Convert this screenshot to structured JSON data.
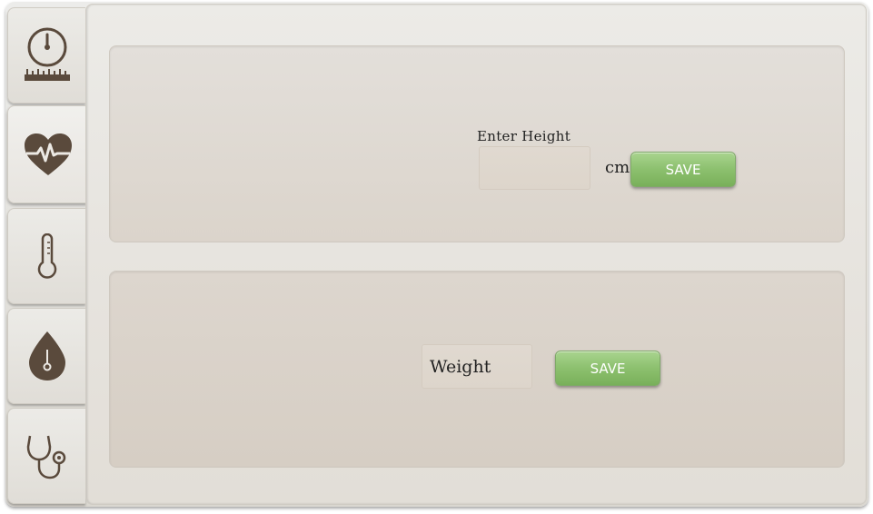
{
  "tabs": [
    {
      "name": "height-weight",
      "icon": "gauge-ruler-icon"
    },
    {
      "name": "heart-rate",
      "icon": "heart-pulse-icon"
    },
    {
      "name": "temperature",
      "icon": "thermometer-icon"
    },
    {
      "name": "blood",
      "icon": "blood-drop-icon"
    },
    {
      "name": "stethoscope",
      "icon": "stethoscope-icon"
    }
  ],
  "height": {
    "label": "Enter Height",
    "value": "",
    "unit": "cm",
    "save_label": "SAVE"
  },
  "weight": {
    "placeholder": "Weight",
    "value": "",
    "save_label": "SAVE"
  },
  "colors": {
    "icon": "#5a4a3c",
    "save_button": "#8cc06e"
  }
}
